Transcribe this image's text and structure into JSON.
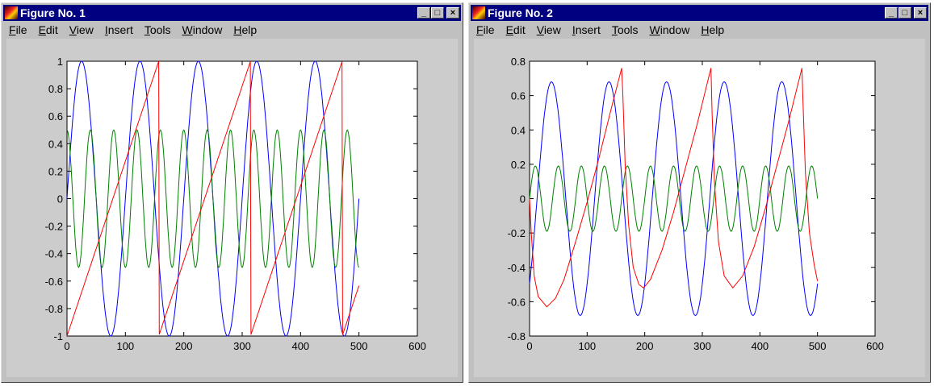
{
  "menu": [
    "File",
    "Edit",
    "View",
    "Insert",
    "Tools",
    "Window",
    "Help"
  ],
  "windows": [
    {
      "title": "Figure No. 1"
    },
    {
      "title": "Figure No. 2"
    }
  ],
  "window_buttons": {
    "minimize": "_",
    "maximize": "□",
    "close": "×"
  },
  "colors": {
    "blue": "#0000ff",
    "green": "#008000",
    "red": "#ff0000"
  },
  "chart_data": [
    {
      "type": "line",
      "xlim": [
        0,
        600
      ],
      "ylim": [
        -1,
        1
      ],
      "xticks": [
        "0",
        "100",
        "200",
        "300",
        "400",
        "500",
        "600"
      ],
      "yticks": [
        "-1",
        "-0.8",
        "-0.6",
        "-0.4",
        "-0.2",
        "0",
        "0.2",
        "0.4",
        "0.6",
        "0.8",
        "1"
      ],
      "x_range": [
        0,
        500
      ],
      "series": [
        {
          "name": "blue",
          "kind": "sine",
          "amplitude": 1,
          "period": 100,
          "phase_shift": 0,
          "offset": 0
        },
        {
          "name": "green",
          "kind": "cosine",
          "amplitude": 0.5,
          "period": 40,
          "phase_shift": 0,
          "offset": 0
        },
        {
          "name": "red",
          "kind": "sawtooth",
          "amplitude": 1,
          "period": 157.08,
          "phase_shift": 0
        }
      ]
    },
    {
      "type": "line",
      "xlim": [
        0,
        600
      ],
      "ylim": [
        -0.8,
        0.8
      ],
      "xticks": [
        "0",
        "100",
        "200",
        "300",
        "400",
        "500",
        "600"
      ],
      "yticks": [
        "-0.8",
        "-0.6",
        "-0.4",
        "-0.2",
        "0",
        "0.2",
        "0.4",
        "0.6",
        "0.8"
      ],
      "x_range": [
        0,
        500
      ],
      "series": [
        {
          "name": "blue",
          "kind": "sine",
          "amplitude": 0.68,
          "period": 100,
          "phase_shift": 13,
          "offset": 0
        },
        {
          "name": "green",
          "kind": "cosine",
          "amplitude": 0.19,
          "period": 40,
          "phase_shift": 10,
          "offset": 0
        },
        {
          "name": "red",
          "kind": "points",
          "points": [
            [
              0,
              0
            ],
            [
              3,
              -0.2
            ],
            [
              8,
              -0.45
            ],
            [
              15,
              -0.57
            ],
            [
              30,
              -0.63
            ],
            [
              45,
              -0.58
            ],
            [
              60,
              -0.47
            ],
            [
              80,
              -0.25
            ],
            [
              100,
              -0.02
            ],
            [
              120,
              0.23
            ],
            [
              140,
              0.5
            ],
            [
              160,
              0.76
            ],
            [
              162,
              0.6
            ],
            [
              166,
              0.2
            ],
            [
              172,
              -0.15
            ],
            [
              180,
              -0.4
            ],
            [
              190,
              -0.5
            ],
            [
              198,
              -0.52
            ],
            [
              210,
              -0.47
            ],
            [
              230,
              -0.3
            ],
            [
              250,
              -0.08
            ],
            [
              270,
              0.17
            ],
            [
              290,
              0.42
            ],
            [
              315,
              0.76
            ],
            [
              317,
              0.5
            ],
            [
              321,
              0.1
            ],
            [
              328,
              -0.25
            ],
            [
              338,
              -0.45
            ],
            [
              353,
              -0.52
            ],
            [
              370,
              -0.45
            ],
            [
              390,
              -0.28
            ],
            [
              410,
              -0.05
            ],
            [
              430,
              0.2
            ],
            [
              450,
              0.45
            ],
            [
              473,
              0.76
            ],
            [
              475,
              0.55
            ],
            [
              479,
              0.15
            ],
            [
              486,
              -0.2
            ],
            [
              494,
              -0.38
            ],
            [
              500,
              -0.48
            ]
          ]
        }
      ]
    }
  ]
}
